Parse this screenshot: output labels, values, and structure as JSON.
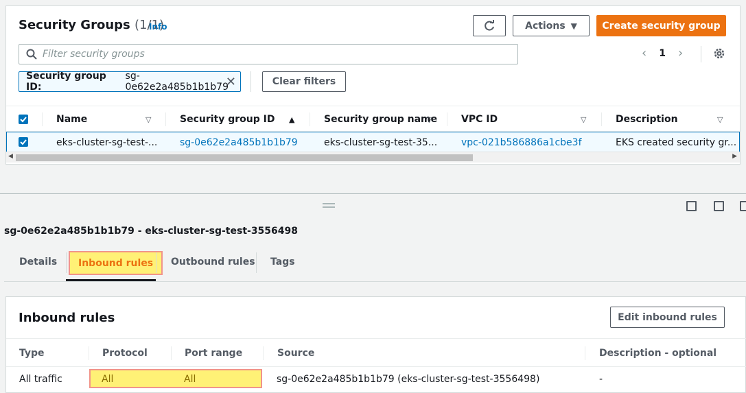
{
  "list": {
    "title": "Security Groups",
    "count": "(1/1)",
    "info": "Info",
    "actions_label": "Actions",
    "create_label": "Create security group",
    "search_placeholder": "Filter security groups",
    "page_number": "1",
    "filter_key": "Security group ID:",
    "filter_value": "sg-0e62e2a485b1b1b79",
    "clear_filters_label": "Clear filters",
    "columns": [
      "Name",
      "Security group ID",
      "Security group name",
      "VPC ID",
      "Description"
    ],
    "rows": [
      {
        "name": "eks-cluster-sg-test-...",
        "sg_id": "sg-0e62e2a485b1b1b79",
        "sg_name": "eks-cluster-sg-test-35...",
        "vpc_id": "vpc-021b586886a1cbe3f",
        "description": "EKS created security gr..."
      }
    ]
  },
  "detail": {
    "title": "sg-0e62e2a485b1b1b79 - eks-cluster-sg-test-3556498",
    "tabs": [
      "Details",
      "Inbound rules",
      "Outbound rules",
      "Tags"
    ],
    "active_tab": "Inbound rules"
  },
  "inbound": {
    "title": "Inbound rules",
    "edit_label": "Edit inbound rules",
    "columns": [
      "Type",
      "Protocol",
      "Port range",
      "Source",
      "Description - optional"
    ],
    "rows": [
      {
        "type": "All traffic",
        "protocol": "All",
        "port_range": "All",
        "source": "sg-0e62e2a485b1b1b79 (eks-cluster-sg-test-3556498)",
        "description": "-"
      }
    ]
  },
  "colors": {
    "accent": "#ec7211",
    "link": "#0073bb",
    "highlight": "#fff176"
  }
}
